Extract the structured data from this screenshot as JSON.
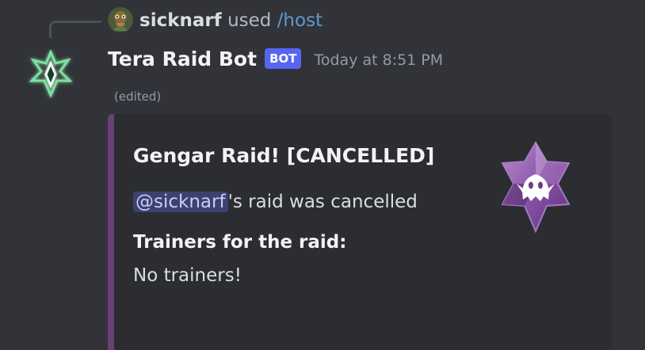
{
  "reply": {
    "username": "sicknarf",
    "used_text": "used",
    "command": "/host"
  },
  "message": {
    "author": "Tera Raid Bot",
    "bot_tag": "BOT",
    "timestamp": "Today at 8:51 PM",
    "edited": "(edited)"
  },
  "embed": {
    "accent_color": "#6b3f78",
    "title": "Gengar Raid! [CANCELLED]",
    "mention": "@sicknarf",
    "description_suffix": "'s raid was cancelled",
    "field_name": "Trainers for the raid:",
    "field_value": "No trainers!",
    "thumbnail_icon": "ghost-tera-type-icon"
  },
  "colors": {
    "background": "#313338",
    "embed_bg": "#2b2d31",
    "bot_tag": "#5865f2",
    "command_link": "#5c9bd6"
  }
}
